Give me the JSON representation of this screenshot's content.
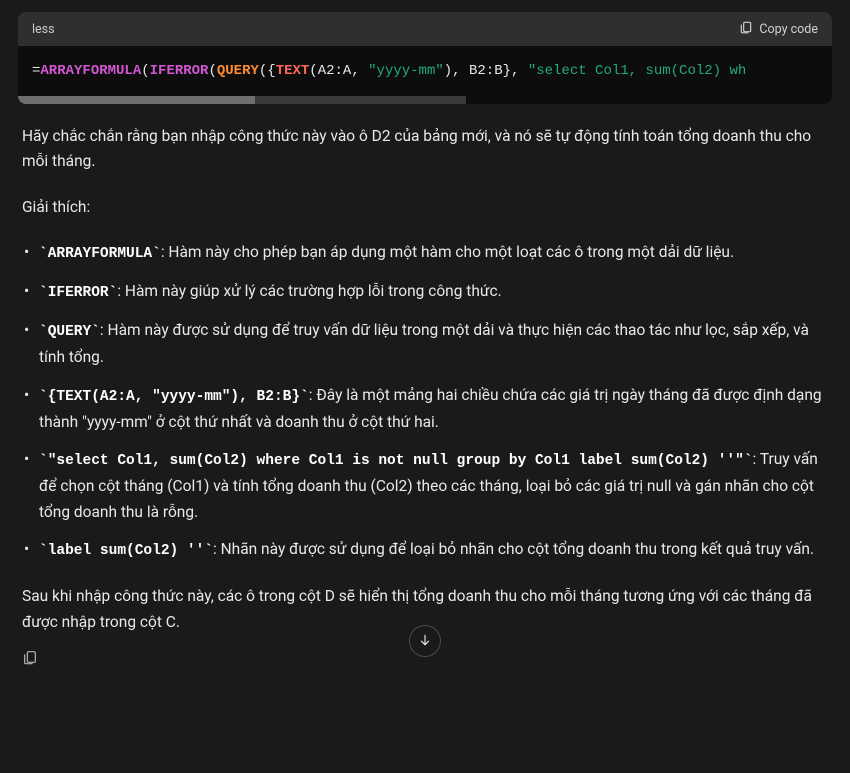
{
  "code": {
    "lang": "less",
    "copy_label": "Copy code",
    "tokens": {
      "eq": "=",
      "arrayformula": "ARRAYFORMULA",
      "iferror": "IFERROR",
      "query": "QUERY",
      "text": "TEXT",
      "ref_a2a": "A2",
      "colon": ":",
      "ref_a": "A",
      "comma_sp": ", ",
      "str_fmt": "\"yyyy-mm\"",
      "rparen": ")",
      "ref_b2": "B2",
      "ref_b": "B",
      "rbrace": "}",
      "lbrace": "{",
      "lparen": "(",
      "str_sel": "\"select Col1, sum(Col2) wh"
    }
  },
  "para_intro": "Hãy chắc chắn rằng bạn nhập công thức này vào ô D2 của bảng mới, và nó sẽ tự động tính toán tổng doanh thu cho mỗi tháng.",
  "explain_label": "Giải thích:",
  "items": {
    "arrayformula": {
      "code": "`ARRAYFORMULA`",
      "desc": ": Hàm này cho phép bạn áp dụng một hàm cho một loạt các ô trong một dải dữ liệu."
    },
    "iferror": {
      "code": "`IFERROR`",
      "desc": ": Hàm này giúp xử lý các trường hợp lỗi trong công thức."
    },
    "query": {
      "code": "`QUERY`",
      "desc": ": Hàm này được sử dụng để truy vấn dữ liệu trong một dải và thực hiện các thao tác như lọc, sắp xếp, và tính tổng."
    },
    "array": {
      "code": "`{TEXT(A2:A, \"yyyy-mm\"), B2:B}`",
      "desc": ": Đây là một mảng hai chiều chứa các giá trị ngày tháng đã được định dạng thành \"yyyy-mm\" ở cột thứ nhất và doanh thu ở cột thứ hai."
    },
    "select": {
      "code": "`\"select Col1, sum(Col2) where Col1 is not null group by Col1 label sum(Col2) ''\"`",
      "desc": ": Truy vấn để chọn cột tháng (Col1) và tính tổng doanh thu (Col2) theo các tháng, loại bỏ các giá trị null và gán nhãn cho cột tổng doanh thu là rỗng."
    },
    "label": {
      "code": "`label sum(Col2) ''`",
      "desc": ": Nhãn này được sử dụng để loại bỏ nhãn cho cột tổng doanh thu trong kết quả truy vấn."
    }
  },
  "para_outro": "Sau khi nhập công thức này, các ô trong cột D sẽ hiển thị tổng doanh thu cho mỗi tháng tương ứng với các tháng đã được nhập trong cột C."
}
